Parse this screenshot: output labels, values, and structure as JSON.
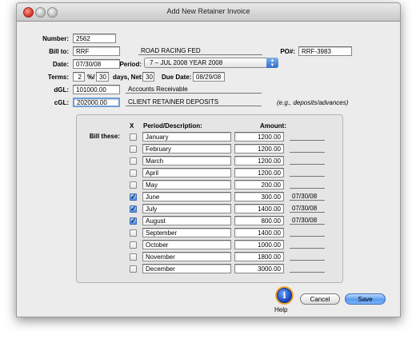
{
  "window": {
    "title": "Add New Retainer Invoice"
  },
  "form": {
    "number_label": "Number:",
    "number": "2562",
    "billto_label": "Bill to:",
    "billto_code": "RRF",
    "billto_name": "ROAD RACING FED",
    "po_label": "PO#:",
    "po": "RRF-3983",
    "date_label": "Date:",
    "date": "07/30/08",
    "period_label": "Period:",
    "period": "7 – JUL 2008 YEAR 2008",
    "terms_label": "Terms:",
    "terms_pct": "2",
    "terms_pct_suffix": "%/",
    "terms_days": "30",
    "terms_days_suffix": "days, Net:",
    "net": "30",
    "due_label": "Due Date:",
    "due": "08/29/08",
    "dgl_label": "dGL:",
    "dgl": "101000.00",
    "dgl_name": "Accounts Receivable",
    "cgl_label": "cGL:",
    "cgl": "202000.00",
    "cgl_name": "CLIENT RETAINER DEPOSITS",
    "cgl_hint": "(e.g., deposits/advances)"
  },
  "bill": {
    "label": "Bill these:",
    "col_x": "X",
    "col_period": "Period/Description:",
    "col_amount": "Amount:",
    "rows": [
      {
        "desc": "January",
        "amount": "1200.00",
        "date": "",
        "checked": false
      },
      {
        "desc": "February",
        "amount": "1200.00",
        "date": "",
        "checked": false
      },
      {
        "desc": "March",
        "amount": "1200.00",
        "date": "",
        "checked": false
      },
      {
        "desc": "April",
        "amount": "1200.00",
        "date": "",
        "checked": false
      },
      {
        "desc": "May",
        "amount": "200.00",
        "date": "",
        "checked": false
      },
      {
        "desc": "June",
        "amount": "300.00",
        "date": "07/30/08",
        "checked": true
      },
      {
        "desc": "July",
        "amount": "1400.00",
        "date": "07/30/08",
        "checked": true
      },
      {
        "desc": "August",
        "amount": "800.00",
        "date": "07/30/08",
        "checked": true
      },
      {
        "desc": "September",
        "amount": "1400.00",
        "date": "",
        "checked": false
      },
      {
        "desc": "October",
        "amount": "1000.00",
        "date": "",
        "checked": false
      },
      {
        "desc": "November",
        "amount": "1800.00",
        "date": "",
        "checked": false
      },
      {
        "desc": "December",
        "amount": "3000.00",
        "date": "",
        "checked": false
      }
    ]
  },
  "footer": {
    "help_label": "Help",
    "help_glyph": "i",
    "cancel_label": "Cancel",
    "save_label": "Save"
  }
}
